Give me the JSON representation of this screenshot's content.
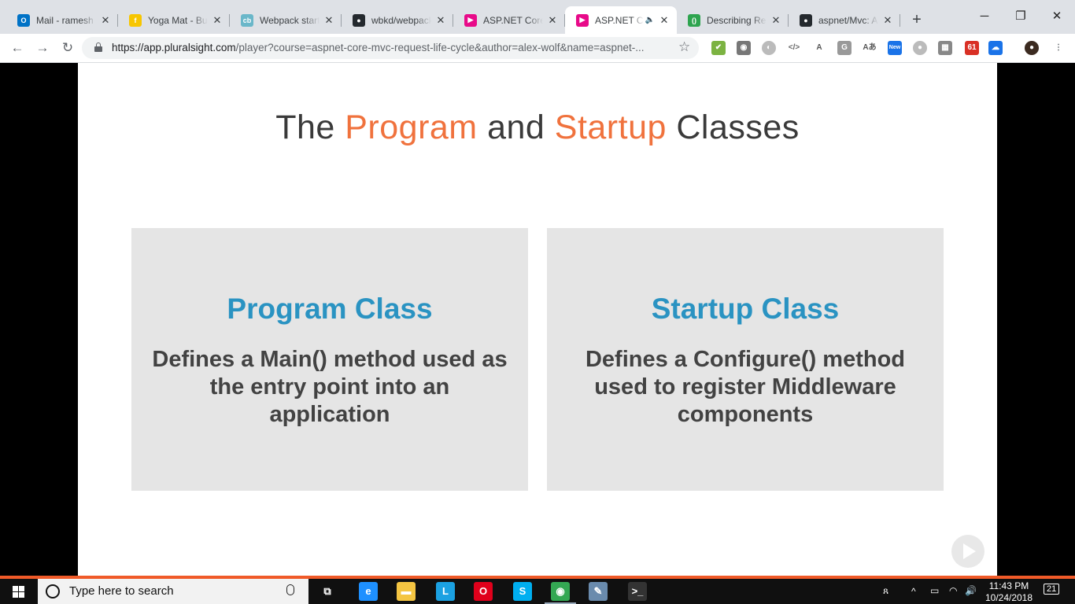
{
  "browser": {
    "tabs": [
      {
        "title": "Mail - ramesh",
        "icon": "outlook-icon",
        "color": "#0072c6",
        "glyph": "O"
      },
      {
        "title": "Yoga Mat - Buy",
        "icon": "flipkart-icon",
        "color": "#f7c600",
        "glyph": "f"
      },
      {
        "title": "Webpack start",
        "icon": "codeburst-icon",
        "color": "#6ab7c9",
        "glyph": "cb"
      },
      {
        "title": "wbkd/webpack",
        "icon": "github-icon",
        "color": "#24292e",
        "glyph": "●"
      },
      {
        "title": "ASP.NET Core",
        "icon": "pluralsight-icon",
        "color": "#e80a89",
        "glyph": "▶"
      },
      {
        "title": "ASP.NET C",
        "icon": "pluralsight-icon",
        "color": "#e80a89",
        "glyph": "▶",
        "active": true,
        "audio": "🔈"
      },
      {
        "title": "Describing Rec",
        "icon": "green-circle-icon",
        "color": "#2ea44f",
        "glyph": "()"
      },
      {
        "title": "aspnet/Mvc: A",
        "icon": "github-icon",
        "color": "#24292e",
        "glyph": "●"
      }
    ],
    "new_tab": "+",
    "window": {
      "minimize": "─",
      "restore": "❐",
      "close": "✕"
    },
    "nav": {
      "back": "←",
      "forward": "→",
      "reload": "↻"
    },
    "url_host": "https://app.pluralsight.com",
    "url_rest": "/player?course=aspnet-core-mvc-request-life-cycle&author=alex-wolf&name=aspnet-...",
    "star": "☆",
    "extensions": [
      {
        "icon": "grammar-check-icon",
        "glyph": "✔",
        "color": "#7cb342"
      },
      {
        "icon": "camera-icon",
        "glyph": "◉",
        "color": "#777"
      },
      {
        "icon": "ghost-icon",
        "glyph": "◐",
        "color": "#bbb"
      },
      {
        "icon": "code-icon",
        "glyph": "</>",
        "color": "#666"
      },
      {
        "icon": "angular-icon",
        "glyph": "A",
        "color": "#555"
      },
      {
        "icon": "google-translate-icon",
        "glyph": "G",
        "color": "#999"
      },
      {
        "icon": "font-icon",
        "glyph": "Aあ",
        "color": "#555"
      },
      {
        "icon": "new-badge-icon",
        "glyph": "New",
        "color": "#1a73e8"
      },
      {
        "icon": "circle-icon",
        "glyph": "●",
        "color": "#bbb"
      },
      {
        "icon": "table-icon",
        "glyph": "▦",
        "color": "#888"
      },
      {
        "icon": "notifications-icon",
        "glyph": "61",
        "color": "#d93025"
      },
      {
        "icon": "cloud-icon",
        "glyph": "☁",
        "color": "#1a73e8"
      },
      {
        "icon": "profile-avatar-icon",
        "glyph": "●",
        "color": "#3b2a20"
      },
      {
        "icon": "menu-icon",
        "glyph": "⋮",
        "color": "#5f6368"
      }
    ]
  },
  "slide": {
    "title_parts": [
      "The ",
      "Program",
      " and ",
      "Startup",
      " Classes"
    ],
    "cards": [
      {
        "title": "Program Class",
        "body": "Defines a Main() method used as the entry point into an application"
      },
      {
        "title": "Startup Class",
        "body": "Defines a Configure() method used to register Middleware components"
      }
    ],
    "accent": "#f0723d",
    "card_title_color": "#2a93c2"
  },
  "taskbar": {
    "search_placeholder": "Type here to search",
    "apps": [
      {
        "icon": "task-view-icon",
        "glyph": "⧉",
        "color": "#101010"
      },
      {
        "icon": "edge-icon",
        "glyph": "e",
        "color": "#1e90ff"
      },
      {
        "icon": "file-explorer-icon",
        "glyph": "▬",
        "color": "#f4c542"
      },
      {
        "icon": "lync-icon",
        "glyph": "L",
        "color": "#1ba1e2"
      },
      {
        "icon": "opera-icon",
        "glyph": "O",
        "color": "#e0001b"
      },
      {
        "icon": "skype-icon",
        "glyph": "S",
        "color": "#00aff0"
      },
      {
        "icon": "chrome-icon",
        "glyph": "◉",
        "color": "#34a853"
      },
      {
        "icon": "paint-icon",
        "glyph": "✎",
        "color": "#6a8bad"
      },
      {
        "icon": "terminal-icon",
        "glyph": ">_",
        "color": "#333"
      }
    ],
    "tray": {
      "people": "ጸ",
      "chevron": "^",
      "battery": "▭",
      "wifi": "◠",
      "volume": "🔊"
    },
    "time": "11:43 PM",
    "date": "10/24/2018",
    "notifications": "21"
  }
}
